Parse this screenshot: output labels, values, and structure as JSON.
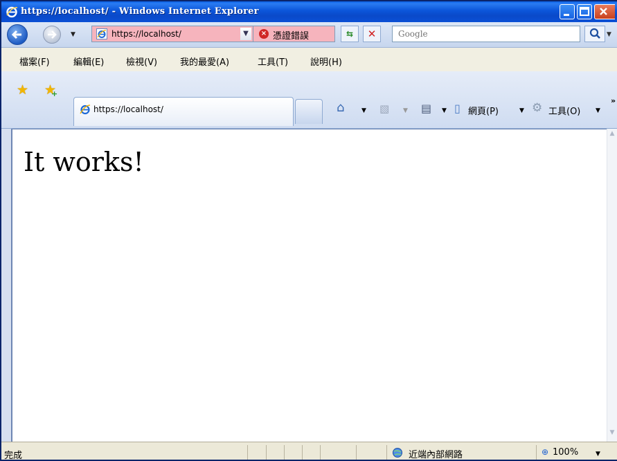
{
  "window": {
    "title": "https://localhost/ - Windows Internet Explorer"
  },
  "nav": {
    "address": "https://localhost/",
    "cert_error": "憑證錯誤",
    "search_placeholder": "Google"
  },
  "menu": {
    "items": [
      "檔案(F)",
      "編輯(E)",
      "檢視(V)",
      "我的最愛(A)",
      "工具(T)",
      "說明(H)"
    ]
  },
  "tabs": {
    "active_label": "https://localhost/"
  },
  "commands": {
    "page": "網頁(P)",
    "tools": "工具(O)"
  },
  "content": {
    "heading": "It works!"
  },
  "status": {
    "text": "完成",
    "zone": "近端內部網路",
    "zoom": "100%"
  },
  "colors": {
    "titlebar": "#0b55d9",
    "cert_error_bg": "#f6b4bd"
  }
}
